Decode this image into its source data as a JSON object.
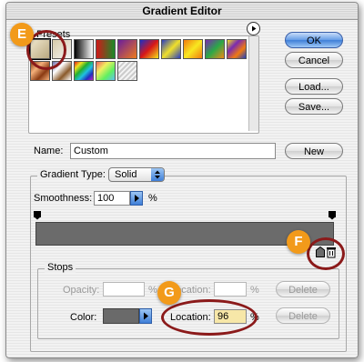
{
  "window": {
    "title": "Gradient Editor"
  },
  "presets": {
    "label": "Presets",
    "menu_icon": "right-arrow-circle-icon",
    "swatches": [
      {
        "name": "foreground-to-background",
        "css": "linear-gradient(135deg,#efe6cc,#b9a880)"
      },
      {
        "name": "foreground-to-transparent",
        "css": "linear-gradient(135deg,#d7cba9,#f2f2f2)"
      },
      {
        "name": "black-white",
        "css": "linear-gradient(90deg,#000,#fff)"
      },
      {
        "name": "red-green",
        "css": "linear-gradient(90deg,#d01818,#1a8a28)"
      },
      {
        "name": "violet-orange",
        "css": "linear-gradient(135deg,#6a1e9c,#ee7a1a)"
      },
      {
        "name": "blue-red-yellow",
        "css": "linear-gradient(135deg,#1a2ec8,#d81818,#f4e21a)"
      },
      {
        "name": "blue-yellow-blue",
        "css": "linear-gradient(135deg,#2a3ec0,#f0e02a,#2a3ec0)"
      },
      {
        "name": "orange-yellow-orange",
        "css": "linear-gradient(135deg,#f07a10,#f8e820,#f07a10)"
      },
      {
        "name": "violet-green-orange",
        "css": "linear-gradient(135deg,#7a2ab0,#2aa848,#f08a18)"
      },
      {
        "name": "yellow-violet-orange-blue",
        "css": "linear-gradient(135deg,#f0e020,#7a2ab0,#f07a10,#2040c0)"
      },
      {
        "name": "copper",
        "css": "linear-gradient(135deg,#8a3a12,#f4b07a,#8a3a12,#f4b07a)"
      },
      {
        "name": "chrome",
        "css": "linear-gradient(135deg,#6a6aa8,#fff,#8a5a2a,#fff)"
      },
      {
        "name": "spectrum",
        "css": "linear-gradient(135deg,#e01818,#f0e020,#20b030,#20c0e0,#2030c0,#c020c0)"
      },
      {
        "name": "transparent-rainbow",
        "css": "linear-gradient(135deg,#f06060,#f0f060,#60f060,#60c0f0)"
      },
      {
        "name": "transparent-stripes",
        "css": "repeating-linear-gradient(135deg,#ccc 0,#ccc 2px,#f4f4f4 2px,#f4f4f4 4px)"
      }
    ]
  },
  "buttons": {
    "ok": "OK",
    "cancel": "Cancel",
    "load": "Load...",
    "save": "Save...",
    "new": "New",
    "delete_opacity": "Delete",
    "delete_color": "Delete"
  },
  "name_field": {
    "label": "Name:",
    "value": "Custom"
  },
  "gradient_type": {
    "label": "Gradient Type:",
    "value": "Solid"
  },
  "smoothness": {
    "label": "Smoothness:",
    "value": "100",
    "unit": "%"
  },
  "stops": {
    "label": "Stops",
    "opacity_label": "Opacity:",
    "opacity_unit": "%",
    "opacity_location_label": "Location:",
    "opacity_location_unit": "%",
    "color_label": "Color:",
    "color_swatch": "#6a6a6a",
    "color_location_label": "Location:",
    "color_location_value": "96",
    "color_location_unit": "%"
  },
  "gradient_bar": {
    "color": "#6b6b6b"
  },
  "callouts": {
    "e": "E",
    "f": "F",
    "g": "G"
  },
  "accent": {
    "callout_orange": "#f29a1a",
    "ring_red": "#8b1a1a",
    "aqua_blue": "#3f7fd8"
  }
}
